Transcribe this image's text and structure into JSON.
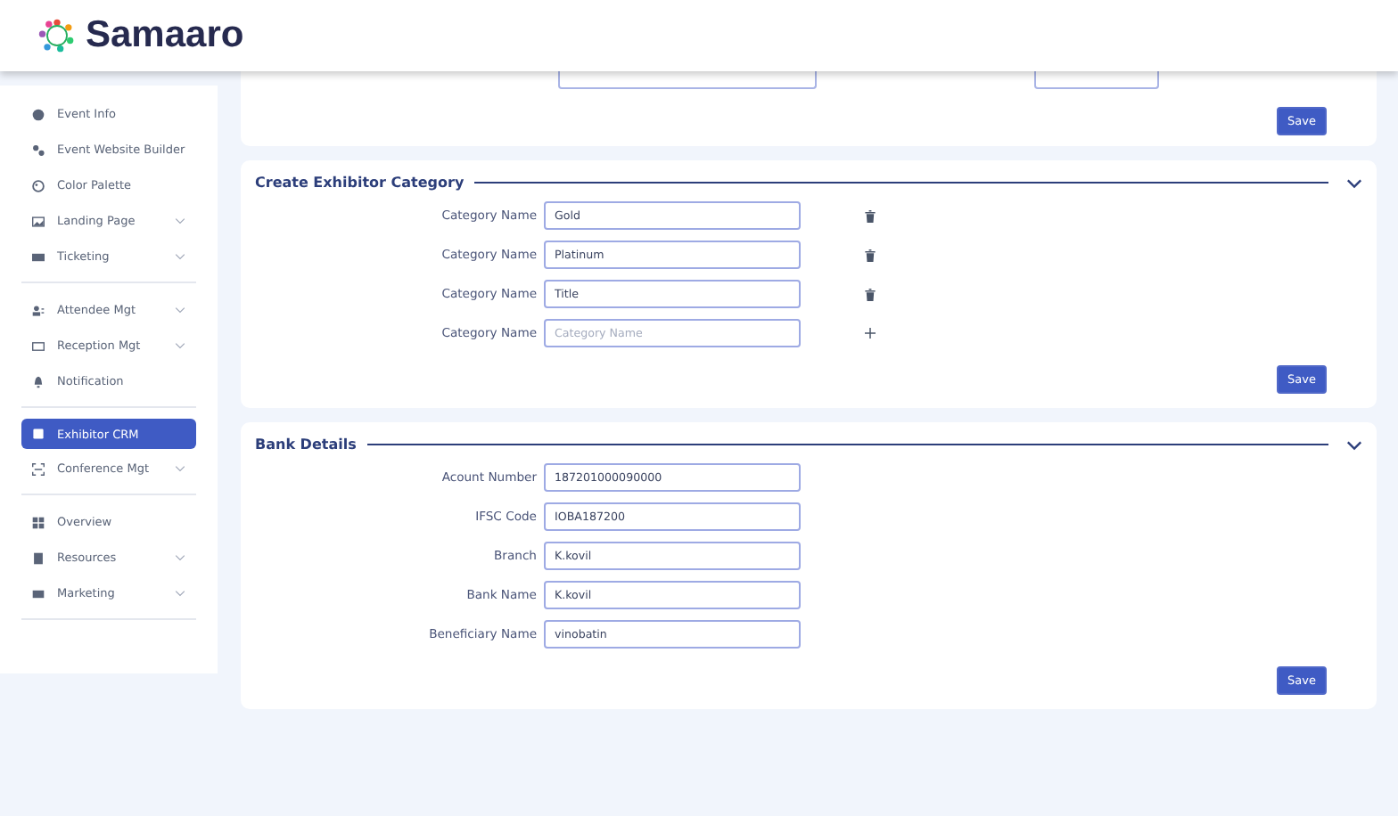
{
  "header": {
    "brand": "Samaaro"
  },
  "sidebar": {
    "groups": [
      {
        "items": [
          {
            "label": "Event Info",
            "expandable": false,
            "selected": false
          },
          {
            "label": "Event Website Builder",
            "expandable": false,
            "selected": false
          },
          {
            "label": "Color Palette",
            "expandable": false,
            "selected": false
          },
          {
            "label": "Landing Page",
            "expandable": true,
            "selected": false
          },
          {
            "label": "Ticketing",
            "expandable": true,
            "selected": false
          }
        ]
      },
      {
        "items": [
          {
            "label": "Attendee Mgt",
            "expandable": true,
            "selected": false
          },
          {
            "label": "Reception Mgt",
            "expandable": true,
            "selected": false
          },
          {
            "label": "Notification",
            "expandable": false,
            "selected": false
          }
        ]
      },
      {
        "items": [
          {
            "label": "Exhibitor CRM",
            "expandable": false,
            "selected": true
          },
          {
            "label": "Conference Mgt",
            "expandable": true,
            "selected": false
          }
        ]
      },
      {
        "items": [
          {
            "label": "Overview",
            "expandable": false,
            "selected": false
          },
          {
            "label": "Resources",
            "expandable": true,
            "selected": false
          },
          {
            "label": "Marketing",
            "expandable": true,
            "selected": false
          }
        ]
      }
    ]
  },
  "top_card": {
    "save_button": "Save"
  },
  "exhibitor_category": {
    "title": "Create Exhibitor Category",
    "rows": [
      {
        "label": "Category Name",
        "value": "Gold",
        "kind": "delete"
      },
      {
        "label": "Category Name",
        "value": "Platinum",
        "kind": "delete"
      },
      {
        "label": "Category Name",
        "value": "Title",
        "kind": "delete"
      },
      {
        "label": "Category Name",
        "placeholder": "Category Name",
        "kind": "add"
      }
    ],
    "save_button": "Save"
  },
  "bank_details": {
    "title": "Bank Details",
    "rows": [
      {
        "label": "Acount Number",
        "value": "187201000090000"
      },
      {
        "label": "IFSC Code",
        "value": "IOBA187200"
      },
      {
        "label": "Branch",
        "value": "K.kovil"
      },
      {
        "label": "Bank Name",
        "value": "K.kovil"
      },
      {
        "label": "Beneficiary Name",
        "value": "vinobatin"
      }
    ],
    "save_button": "Save"
  }
}
